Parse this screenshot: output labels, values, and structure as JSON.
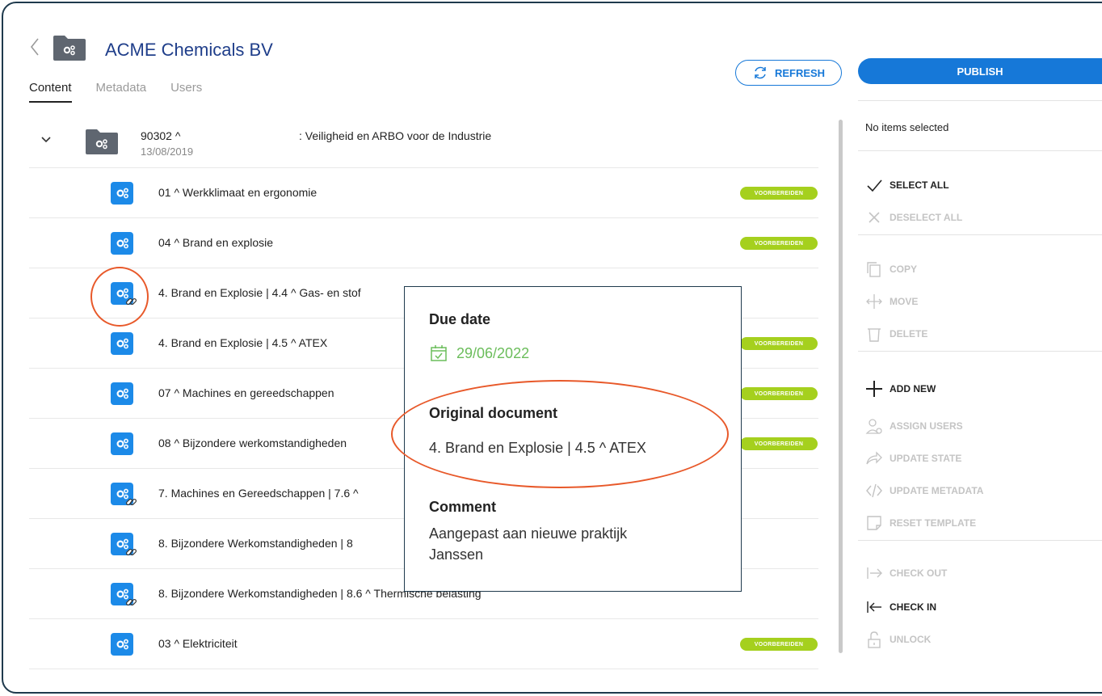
{
  "header": {
    "title": "ACME Chemicals BV",
    "tabs": [
      "Content",
      "Metadata",
      "Users"
    ],
    "refresh_label": "REFRESH"
  },
  "parent": {
    "code": "90302 ^",
    "title": ": Veiligheid en ARBO voor de Industrie",
    "date": "13/08/2019"
  },
  "items": [
    {
      "label": "01 ^ Werkklimaat en ergonomie",
      "badge": "VOORBEREIDEN",
      "linked": false
    },
    {
      "label": "04 ^ Brand en explosie",
      "badge": "VOORBEREIDEN",
      "linked": false
    },
    {
      "label": "4. Brand en Explosie | 4.4 ^ Gas- en stof",
      "badge": "",
      "linked": true
    },
    {
      "label": "4. Brand en Explosie | 4.5 ^ ATEX",
      "badge": "VOORBEREIDEN",
      "linked": false
    },
    {
      "label": "07 ^ Machines en gereedschappen",
      "badge": "VOORBEREIDEN",
      "linked": false
    },
    {
      "label": "08 ^ Bijzondere werkomstandigheden",
      "badge": "VOORBEREIDEN",
      "linked": false
    },
    {
      "label": "7. Machines en Gereedschappen | 7.6 ^",
      "badge": "",
      "linked": true
    },
    {
      "label": "8. Bijzondere Werkomstandigheden | 8",
      "badge": "",
      "linked": true
    },
    {
      "label": "8. Bijzondere Werkomstandigheden | 8.6 ^ Thermische belasting",
      "badge": "",
      "linked": true
    },
    {
      "label": "03 ^ Elektriciteit",
      "badge": "VOORBEREIDEN",
      "linked": false
    }
  ],
  "panel": {
    "publish_label": "PUBLISH",
    "selection_status": "No items selected",
    "actions": [
      {
        "label": "SELECT ALL",
        "icon": "check-icon",
        "enabled": true
      },
      {
        "label": "DESELECT ALL",
        "icon": "x-icon",
        "enabled": false
      },
      {
        "label": "COPY",
        "icon": "copy-icon",
        "enabled": false
      },
      {
        "label": "MOVE",
        "icon": "move-icon",
        "enabled": false
      },
      {
        "label": "DELETE",
        "icon": "trash-icon",
        "enabled": false
      },
      {
        "label": "ADD NEW",
        "icon": "plus-icon",
        "enabled": true
      },
      {
        "label": "ASSIGN USERS",
        "icon": "user-icon",
        "enabled": false
      },
      {
        "label": "UPDATE STATE",
        "icon": "state-arrow-icon",
        "enabled": false
      },
      {
        "label": "UPDATE METADATA",
        "icon": "code-icon",
        "enabled": false
      },
      {
        "label": "RESET TEMPLATE",
        "icon": "note-icon",
        "enabled": false
      },
      {
        "label": "CHECK OUT",
        "icon": "check-out-icon",
        "enabled": false
      },
      {
        "label": "CHECK IN",
        "icon": "check-in-icon",
        "enabled": true
      },
      {
        "label": "UNLOCK",
        "icon": "unlock-icon",
        "enabled": false
      }
    ]
  },
  "tooltip": {
    "due_date_heading": "Due date",
    "due_date": "29/06/2022",
    "original_heading": "Original document",
    "original_value": "4. Brand en Explosie | 4.5 ^ ATEX",
    "comment_heading": "Comment",
    "comment_line1": "Aangepast aan nieuwe praktijk",
    "comment_line2": "Janssen"
  },
  "colors": {
    "accent": "#1678d8",
    "badge": "#a5d01e",
    "highlight": "#e8592a",
    "title": "#1f3e8a"
  }
}
